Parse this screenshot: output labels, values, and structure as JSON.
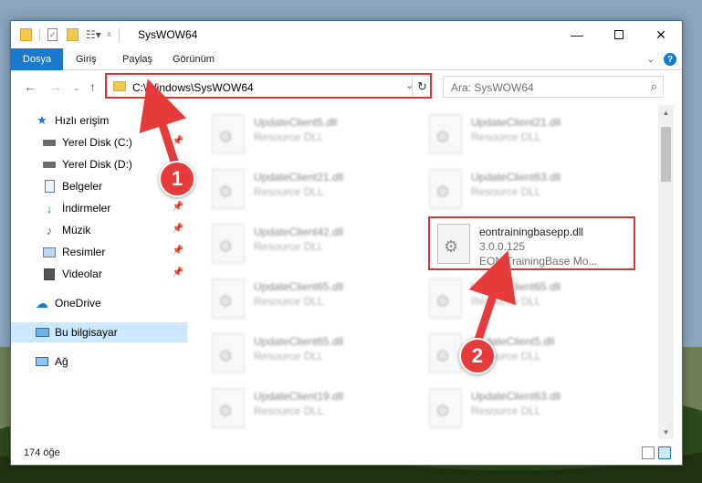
{
  "window": {
    "title": "SysWOW64"
  },
  "ribbon": {
    "tabs": [
      "Dosya",
      "Giriş",
      "Paylaş",
      "Görünüm"
    ]
  },
  "address": {
    "path": "C:\\Windows\\SysWOW64"
  },
  "search": {
    "placeholder": "Ara: SysWOW64"
  },
  "sidebar": {
    "items": [
      {
        "label": "Hızlı erişim",
        "icon": "star-icon"
      },
      {
        "label": "Yerel Disk (C:)",
        "icon": "drive-icon",
        "pinned": true
      },
      {
        "label": "Yerel Disk (D:)",
        "icon": "drive-icon"
      },
      {
        "label": "Belgeler",
        "icon": "documents-icon",
        "pinned": true
      },
      {
        "label": "İndirmeler",
        "icon": "download-icon",
        "pinned": true
      },
      {
        "label": "Müzik",
        "icon": "music-icon",
        "pinned": true
      },
      {
        "label": "Resimler",
        "icon": "pictures-icon",
        "pinned": true
      },
      {
        "label": "Videolar",
        "icon": "videos-icon",
        "pinned": true
      },
      {
        "label": "OneDrive",
        "icon": "cloud-icon"
      },
      {
        "label": "Bu bilgisayar",
        "icon": "computer-icon",
        "selected": true
      },
      {
        "label": "Ağ",
        "icon": "network-icon"
      }
    ]
  },
  "files": {
    "left": [
      {
        "name": "UpdateClient5.dll",
        "desc": "Resource DLL"
      },
      {
        "name": "UpdateClient21.dll",
        "desc": "Resource DLL"
      },
      {
        "name": "UpdateClient42.dll",
        "desc": "Resource DLL"
      },
      {
        "name": "UpdateClient65.dll",
        "desc": "Resource DLL"
      },
      {
        "name": "UpdateClient65.dll",
        "desc": "Resource DLL"
      },
      {
        "name": "UpdateClient19.dll",
        "desc": "Resource DLL"
      }
    ],
    "right": [
      {
        "name": "UpdateClient21.dll",
        "desc": "Resource DLL"
      },
      {
        "name": "UpdateClient63.dll",
        "desc": "Resource DLL"
      },
      {
        "name": "UpdateClient65.dll",
        "desc": "Resource DLL"
      },
      {
        "name": "UpdateClient5.dll",
        "desc": "Resource DLL"
      },
      {
        "name": "UpdateClient63.dll",
        "desc": "Resource DLL"
      }
    ],
    "highlighted": {
      "name": "eontrainingbasepp.dll",
      "version": "3.0.0.125",
      "desc": "EON TrainingBase Mo..."
    }
  },
  "status": {
    "count": "174 öğe"
  },
  "callouts": {
    "one": "1",
    "two": "2"
  },
  "colors": {
    "accent": "#1979ca",
    "highlight_box": "#d8353a",
    "badge": "#e63b3b",
    "selected_bg": "#cce8ff"
  }
}
